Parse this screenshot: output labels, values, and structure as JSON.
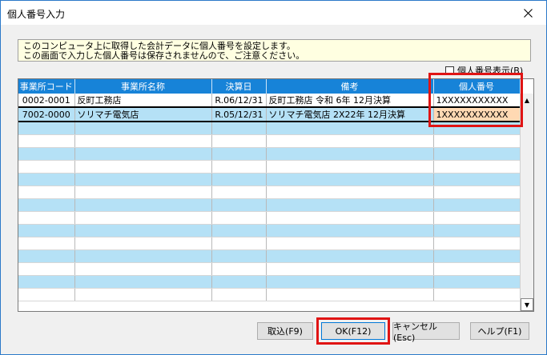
{
  "window": {
    "title": "個人番号入力"
  },
  "notice": {
    "line1": "このコンピュータ上に取得した会計データに個人番号を設定します。",
    "line2": "この画面で入力した個人番号は保存されませんので、ご注意ください。"
  },
  "show_checkbox": {
    "label": "個人番号表示(B)",
    "checked": false
  },
  "table": {
    "headers": [
      "事業所コード",
      "事業所名称",
      "決算日",
      "備考",
      "個人番号"
    ],
    "rows": [
      [
        "0002-0001",
        "反町工務店",
        "R.06/12/31",
        "反町工務店 令和 6年 12月決算",
        "1XXXXXXXXXXX"
      ],
      [
        "7002-0000",
        "ソリマチ電気店",
        "R.05/12/31",
        "ソリマチ電気店 2X22年 12月決算",
        "1XXXXXXXXXXX"
      ]
    ],
    "selected_row": 1,
    "empty_row_count": 14
  },
  "buttons": {
    "import": "取込(F9)",
    "ok": "OK(F12)",
    "cancel": "キャンセル(Esc)",
    "help": "ヘルプ(F1)"
  },
  "colors": {
    "header": "#1783d8",
    "row_alt": "#b5e1f6",
    "selected_cell": "#ffd9b3",
    "highlight": "#e01414"
  }
}
